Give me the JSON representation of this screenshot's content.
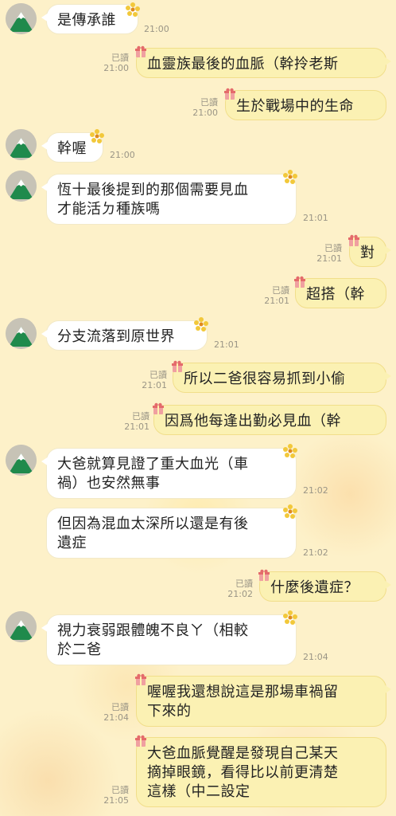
{
  "messages": [
    {
      "side": "in",
      "avatar": true,
      "text": [
        "是傳承誰"
      ],
      "time": "21:00"
    },
    {
      "side": "out",
      "text": [
        "血靈族最後的血脈（幹拎老斯"
      ],
      "read": "已讀",
      "time": "21:00"
    },
    {
      "side": "out",
      "text": [
        "生於戰場中的生命"
      ],
      "read": "已讀",
      "time": "21:00"
    },
    {
      "side": "in",
      "avatar": true,
      "text": [
        "幹喔"
      ],
      "time": "21:00"
    },
    {
      "side": "in",
      "avatar": true,
      "text": [
        "恆十最後提到的那個需要見血",
        "才能活ㄉ種族嗎"
      ],
      "time": "21:01"
    },
    {
      "side": "out",
      "text": [
        "對"
      ],
      "read": "已讀",
      "time": "21:01"
    },
    {
      "side": "out",
      "text": [
        "超搭（幹"
      ],
      "read": "已讀",
      "time": "21:01"
    },
    {
      "side": "in",
      "avatar": true,
      "text": [
        "分支流落到原世界"
      ],
      "time": "21:01"
    },
    {
      "side": "out",
      "text": [
        "所以二爸很容易抓到小偷"
      ],
      "read": "已讀",
      "time": "21:01"
    },
    {
      "side": "out",
      "text": [
        "因爲他每逢出勤必見血（幹"
      ],
      "read": "已讀",
      "time": "21:01"
    },
    {
      "side": "in",
      "avatar": true,
      "text": [
        "大爸就算見證了重大血光（車",
        "禍）也安然無事"
      ],
      "time": "21:02"
    },
    {
      "side": "in",
      "text": [
        "但因為混血太深所以還是有後",
        "遺症"
      ],
      "time": "21:02"
    },
    {
      "side": "out",
      "text": [
        "什麼後遺症？"
      ],
      "read": "已讀",
      "time": "21:02"
    },
    {
      "side": "in",
      "avatar": true,
      "text": [
        "視力衰弱跟體魄不良ㄚ（相較",
        "於二爸"
      ],
      "time": "21:04"
    },
    {
      "side": "out",
      "text": [
        "喔喔我還想說這是那場車禍留",
        "下來的"
      ],
      "read": "已讀",
      "time": "21:04"
    },
    {
      "side": "out",
      "text": [
        "大爸血脈覺醒是發現自己某天",
        "摘掉眼鏡，看得比以前更清楚",
        "這樣（中二設定"
      ],
      "read": "已讀",
      "time": "21:05"
    }
  ],
  "colors": {
    "incoming_bubble": "#ffffff",
    "outgoing_bubble": "#fbf1b3",
    "background": "#fdf1c9",
    "meta_text": "#9a9586"
  },
  "icons": {
    "avatar": "mountain-avatar-icon",
    "incoming_decoration": "yellow-flower-icon",
    "outgoing_decoration": "gift-icon"
  }
}
